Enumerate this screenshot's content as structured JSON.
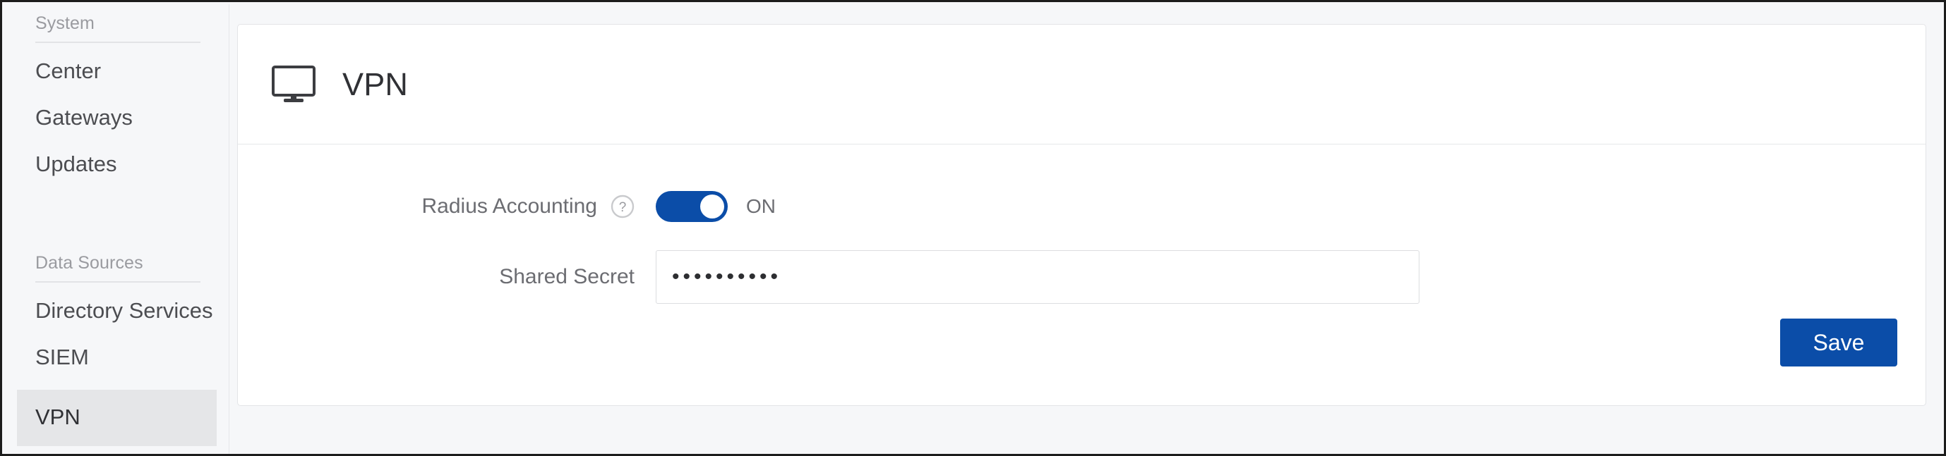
{
  "theme": {
    "accent": "#0b4da8",
    "page_background": "#f6f7f9",
    "card_background": "#ffffff",
    "selected_item_background": "#e5e6e8",
    "label_text": "#6c6d72",
    "muted_text": "#9a9ba0"
  },
  "sidebar": {
    "groups": [
      {
        "header": "System",
        "items": [
          {
            "label": "Center",
            "selected": false
          },
          {
            "label": "Gateways",
            "selected": false
          },
          {
            "label": "Updates",
            "selected": false
          }
        ]
      },
      {
        "header": "Data Sources",
        "items": [
          {
            "label": "Directory Services",
            "selected": false
          },
          {
            "label": "SIEM",
            "selected": false
          },
          {
            "label": "VPN",
            "selected": true
          }
        ]
      }
    ]
  },
  "card": {
    "icon": "monitor-icon",
    "title": "VPN",
    "fields": {
      "radius_accounting": {
        "label": "Radius Accounting",
        "help_icon": "question-circle-icon",
        "toggle_state": "ON",
        "toggle_on": true
      },
      "shared_secret": {
        "label": "Shared Secret",
        "value": "••••••••••",
        "placeholder": ""
      }
    },
    "save_label": "Save"
  }
}
